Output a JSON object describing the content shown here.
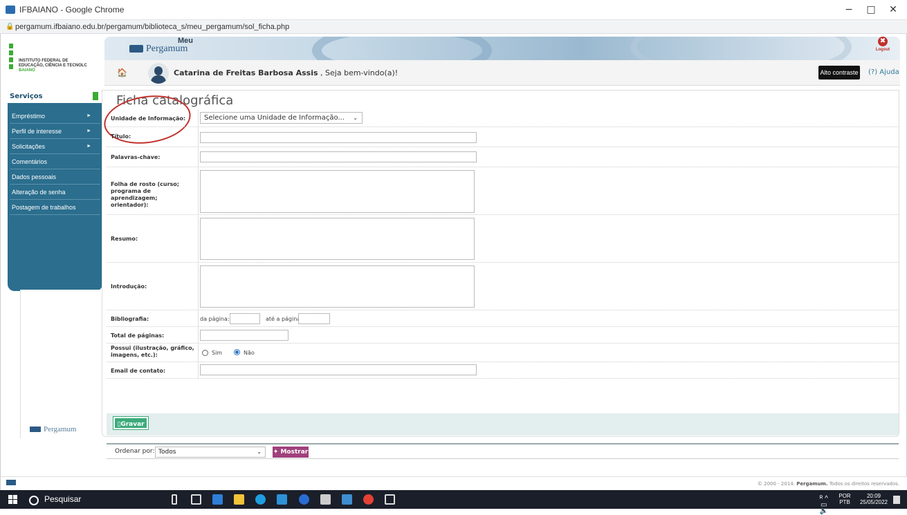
{
  "window": {
    "title": "IFBAIANO - Google Chrome",
    "url": "pergamum.ifbaiano.edu.br/pergamum/biblioteca_s/meu_pergamum/sol_ficha.php",
    "minimize": "−",
    "maximize": "□",
    "close": "✕"
  },
  "header": {
    "institution": [
      "INSTITUTO FEDERAL DE",
      "EDUCAÇÃO, CIÊNCIA E TECNOLC",
      "BAIANO"
    ],
    "meu": "Meu",
    "pergamum": "Pergamum",
    "logout": "Logout",
    "user_name": "Catarina de Freitas Barbosa Assis",
    "welcome": " , Seja bem-vindo(a)!",
    "alto_contraste": "Alto contraste",
    "ajuda": "(?) Ajuda"
  },
  "sidebar": {
    "title": "Serviços",
    "items": [
      {
        "label": "Empréstimo",
        "arrow": "►"
      },
      {
        "label": "Perfil de interesse",
        "arrow": "►"
      },
      {
        "label": "Solicitações",
        "arrow": "►"
      },
      {
        "label": "Comentários",
        "arrow": ""
      },
      {
        "label": "Dados pessoais",
        "arrow": ""
      },
      {
        "label": "Alteração de senha",
        "arrow": ""
      },
      {
        "label": "Postagem de trabalhos",
        "arrow": ""
      }
    ],
    "logo": "Pergamum"
  },
  "form": {
    "title": "Ficha catalográfica",
    "unidade_label": "Unidade de Informação:",
    "unidade_value": "Selecione uma Unidade de Informação...",
    "titulo_label": "Título:",
    "palavras_label": "Palavras-chave:",
    "folha_label": "Folha de rosto (curso; programa de aprendizagem; orientador):",
    "resumo_label": "Resumo:",
    "introducao_label": "Introdução:",
    "bibliografia_label": "Bibliografia:",
    "da_pagina": "da página:",
    "ate_pagina": "até a página",
    "total_label": "Total de páginas:",
    "possui_label": "Possui (ilustração, gráfico, imagens, etc.):",
    "sim": "Sim",
    "nao": "Não",
    "email_label": "Email de contato:",
    "gravar": "Gravar",
    "ordenar_label": "Ordenar por:",
    "ordenar_value": "Todos",
    "mostrar": "Mostrar"
  },
  "footer": {
    "copyright_pre": "© 2000 - 2014. ",
    "copyright_brand": "Pergamum.",
    "copyright_post": " Todos os direitos reservados."
  },
  "taskbar": {
    "search": "Pesquisar",
    "lang": "POR",
    "lang2": "PTB",
    "time": "20:09",
    "date": "25/05/2022"
  },
  "colors": {
    "sidebar": "#2b6e8e",
    "accent_green": "#3cab35",
    "mostrar": "#a0407c",
    "logout_red": "#c0302b"
  }
}
